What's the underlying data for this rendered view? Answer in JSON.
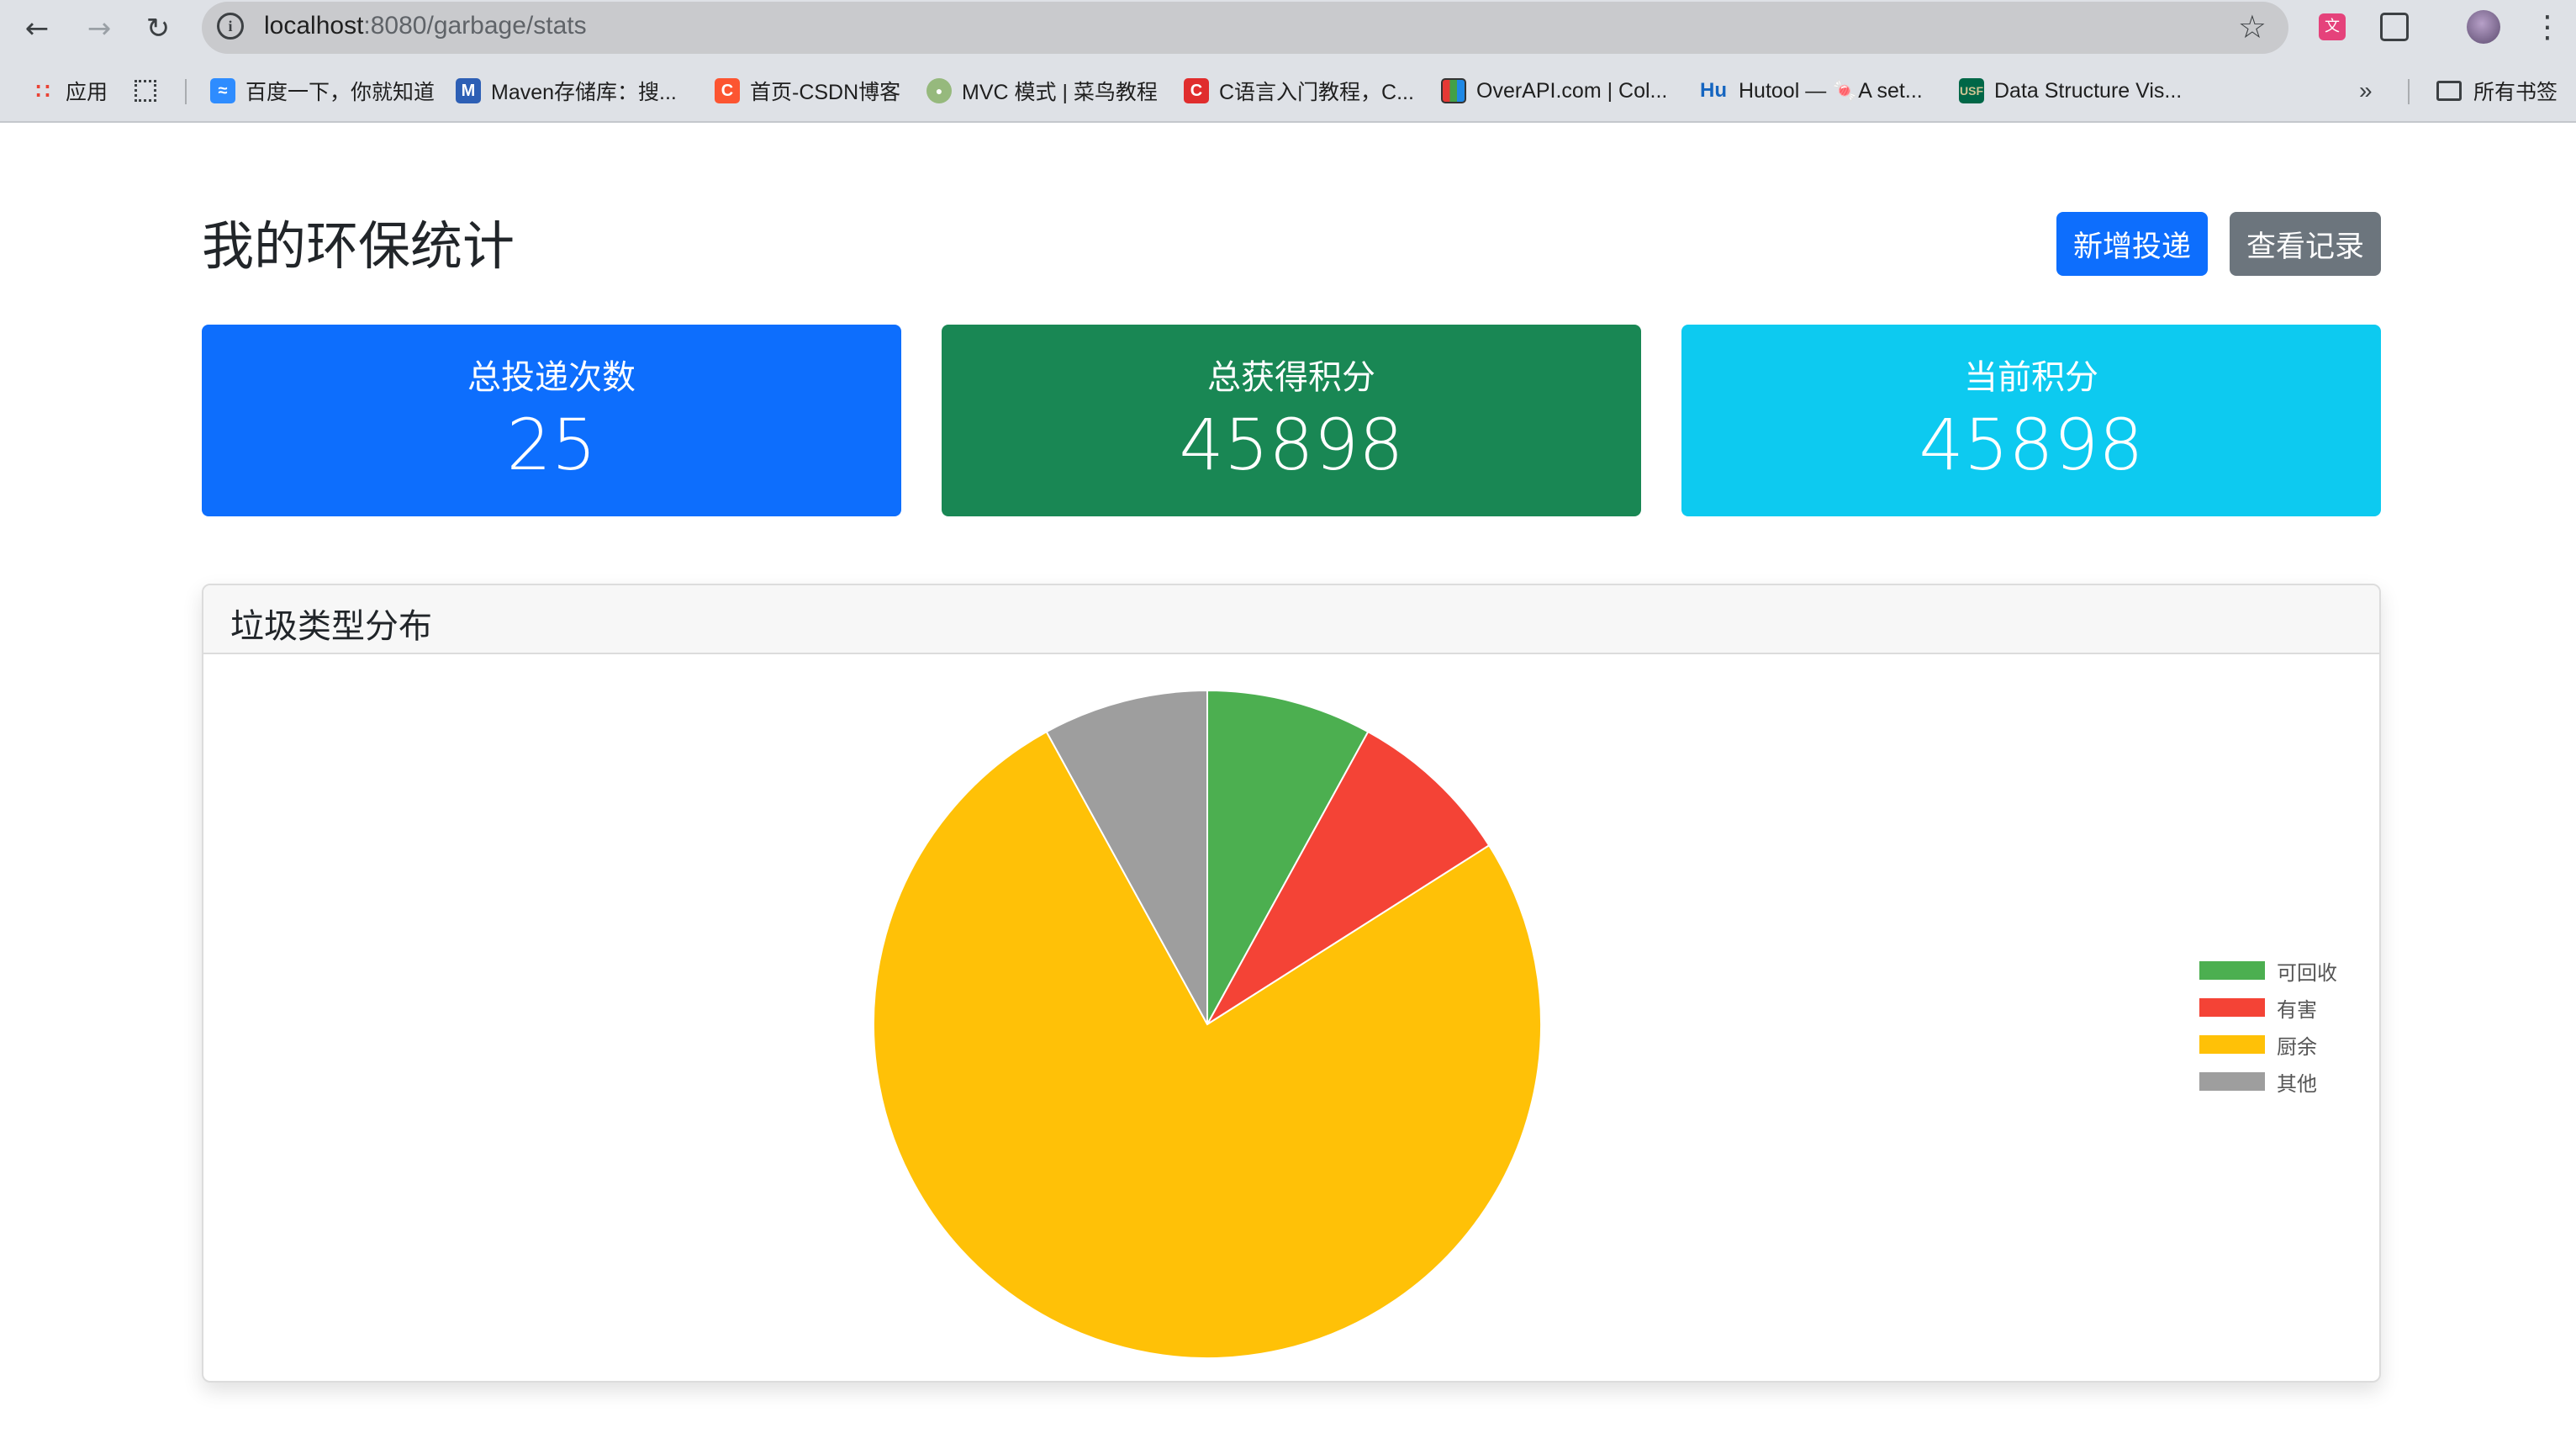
{
  "browser": {
    "url_host": "localhost",
    "url_rest": ":8080/garbage/stats",
    "bookmarks": [
      {
        "label": "应用",
        "icon": "apps-grid-icon",
        "color": "#ea4335"
      },
      {
        "label": "百度一下，你就知道",
        "icon": "baidu-icon",
        "color": "#2e8cff"
      },
      {
        "label": "Maven存储库：搜...",
        "icon": "maven-icon",
        "color": "#2d5fb5"
      },
      {
        "label": "首页-CSDN博客",
        "icon": "csdn-icon",
        "color": "#fc5531"
      },
      {
        "label": "MVC 模式 | 菜鸟教程",
        "icon": "runoob-icon",
        "color": "#96b97d"
      },
      {
        "label": "C语言入门教程，C...",
        "icon": "c-lang-icon",
        "color": "#e02d2d"
      },
      {
        "label": "OverAPI.com | Col...",
        "icon": "overapi-icon",
        "color": "#3a3a3a"
      },
      {
        "label": "Hutool — 🍬A set...",
        "icon": "hutool-icon",
        "color": "#1565c0"
      },
      {
        "label": "Data Structure Vis...",
        "icon": "usf-icon",
        "color": "#006747"
      }
    ],
    "all_bookmarks_label": "所有书签"
  },
  "page": {
    "title": "我的环保统计",
    "new_button": "新增投递",
    "records_button": "查看记录"
  },
  "stats": [
    {
      "label": "总投递次数",
      "value": "25",
      "color": "#0d6efd"
    },
    {
      "label": "总获得积分",
      "value": "45898",
      "color": "#198754"
    },
    {
      "label": "当前积分",
      "value": "45898",
      "color": "#0dcaf0"
    }
  ],
  "panel": {
    "title": "垃圾类型分布"
  },
  "chart_data": {
    "type": "pie",
    "categories": [
      "可回收",
      "有害",
      "厨余",
      "其他"
    ],
    "values": [
      2,
      2,
      19,
      2
    ],
    "colors": [
      "#4caf50",
      "#f44336",
      "#ffc107",
      "#9e9e9e"
    ],
    "legend": "right",
    "start_angle": "top",
    "direction": "clockwise"
  }
}
